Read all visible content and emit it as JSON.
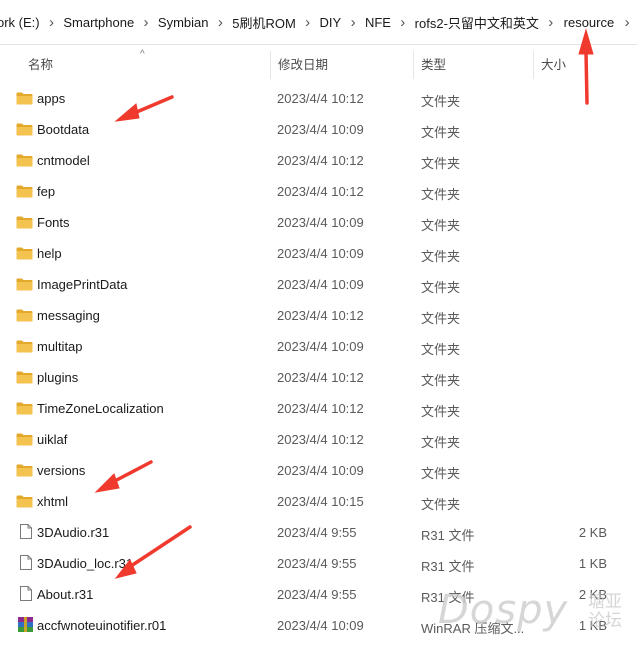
{
  "breadcrumb": [
    "ork (E:)",
    "Smartphone",
    "Symbian",
    "5刷机ROM",
    "DIY",
    "NFE",
    "rofs2-只留中文和英文",
    "resource"
  ],
  "columns": {
    "name": "名称",
    "date": "修改日期",
    "type": "类型",
    "size": "大小"
  },
  "files": [
    {
      "name": "apps",
      "date": "2023/4/4 10:12",
      "type": "文件夹",
      "size": "",
      "kind": "folder"
    },
    {
      "name": "Bootdata",
      "date": "2023/4/4 10:09",
      "type": "文件夹",
      "size": "",
      "kind": "folder"
    },
    {
      "name": "cntmodel",
      "date": "2023/4/4 10:12",
      "type": "文件夹",
      "size": "",
      "kind": "folder"
    },
    {
      "name": "fep",
      "date": "2023/4/4 10:12",
      "type": "文件夹",
      "size": "",
      "kind": "folder"
    },
    {
      "name": "Fonts",
      "date": "2023/4/4 10:09",
      "type": "文件夹",
      "size": "",
      "kind": "folder"
    },
    {
      "name": "help",
      "date": "2023/4/4 10:09",
      "type": "文件夹",
      "size": "",
      "kind": "folder"
    },
    {
      "name": "ImagePrintData",
      "date": "2023/4/4 10:09",
      "type": "文件夹",
      "size": "",
      "kind": "folder"
    },
    {
      "name": "messaging",
      "date": "2023/4/4 10:12",
      "type": "文件夹",
      "size": "",
      "kind": "folder"
    },
    {
      "name": "multitap",
      "date": "2023/4/4 10:09",
      "type": "文件夹",
      "size": "",
      "kind": "folder"
    },
    {
      "name": "plugins",
      "date": "2023/4/4 10:12",
      "type": "文件夹",
      "size": "",
      "kind": "folder"
    },
    {
      "name": "TimeZoneLocalization",
      "date": "2023/4/4 10:12",
      "type": "文件夹",
      "size": "",
      "kind": "folder"
    },
    {
      "name": "uiklaf",
      "date": "2023/4/4 10:12",
      "type": "文件夹",
      "size": "",
      "kind": "folder"
    },
    {
      "name": "versions",
      "date": "2023/4/4 10:09",
      "type": "文件夹",
      "size": "",
      "kind": "folder"
    },
    {
      "name": "xhtml",
      "date": "2023/4/4 10:15",
      "type": "文件夹",
      "size": "",
      "kind": "folder"
    },
    {
      "name": "3DAudio.r31",
      "date": "2023/4/4 9:55",
      "type": "R31 文件",
      "size": "2 KB",
      "kind": "file"
    },
    {
      "name": "3DAudio_loc.r31",
      "date": "2023/4/4 9:55",
      "type": "R31 文件",
      "size": "1 KB",
      "kind": "file"
    },
    {
      "name": "About.r31",
      "date": "2023/4/4 9:55",
      "type": "R31 文件",
      "size": "2 KB",
      "kind": "file"
    },
    {
      "name": "accfwnoteuinotifier.r01",
      "date": "2023/4/4 10:09",
      "type": "WinRAR 压缩文...",
      "size": "1 KB",
      "kind": "rar"
    }
  ],
  "watermark": {
    "main": "Dospy",
    "side_top": "塘亚",
    "side_bottom": "论坛"
  },
  "colors": {
    "folder": "#F4C24F",
    "folder_dark": "#E3A92C",
    "arrow": "#F03A2E"
  }
}
